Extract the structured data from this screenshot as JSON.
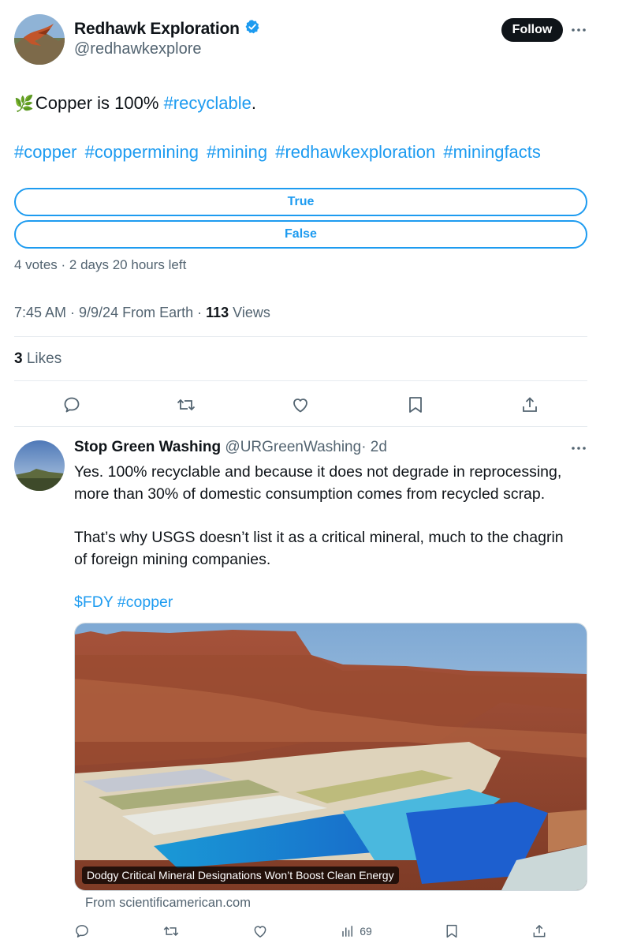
{
  "author": {
    "name": "Redhawk Exploration",
    "handle": "@redhawkexplore",
    "follow_label": "Follow"
  },
  "tweet": {
    "emoji": "🌿",
    "text_prefix": "Copper is 100% ",
    "hashtag_main": "#recyclable",
    "text_suffix": ".",
    "hashtags": [
      "#copper",
      "#coppermining",
      "#mining",
      "#redhawkexploration",
      "#miningfacts"
    ]
  },
  "poll": {
    "options": [
      "True",
      "False"
    ],
    "meta": "4 votes · 2 days 20 hours left"
  },
  "meta": {
    "time": "7:45 AM · 9/9/24 From Earth · ",
    "views_count": "113",
    "views_label": " Views"
  },
  "likes": {
    "count": "3",
    "label": " Likes"
  },
  "reply": {
    "name": "Stop Green Washing",
    "handle": "@URGreenWashing",
    "time": "· 2d",
    "paragraph1_line1": "Yes. 100% recyclable and because it does not degrade in reprocessing,",
    "paragraph1_line2": "more than 30% of domestic consumption comes from recycled scrap.",
    "paragraph2_line1": "That’s why USGS doesn’t list it as a critical mineral, much to the chagrin",
    "paragraph2_line2": "of foreign mining companies.",
    "cashtag": "$FDY",
    "hashtag": "#copper",
    "card_caption": "Dodgy Critical Mineral Designations Won’t Boost Clean Energy",
    "card_source": "From scientificamerican.com",
    "views": "69"
  },
  "colors": {
    "link": "#1d9bf0",
    "muted": "#536471",
    "text": "#0f1419"
  }
}
